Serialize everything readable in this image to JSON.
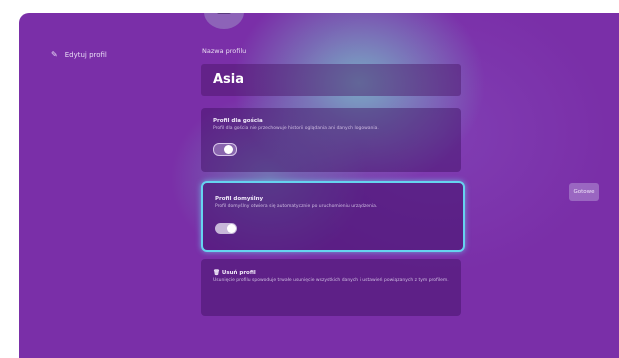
{
  "sidebar": {
    "item": {
      "icon": "pencil-icon",
      "label": "Edytuj profil"
    }
  },
  "profile": {
    "name_label": "Nazwa profilu",
    "name_value": "Asia"
  },
  "cards": {
    "guest": {
      "title": "Profil dla gościa",
      "description": "Profil dla gościa nie przechowuje historii oglądania ani danych logowania.",
      "toggle_on": false
    },
    "default": {
      "title": "Profil domyślny",
      "description": "Profil domyślny otwiera się automatycznie po uruchomieniu urządzenia.",
      "toggle_on": true
    },
    "delete": {
      "icon": "trash-icon",
      "title": "Usuń profil",
      "description": "Usunięcie profilu spowoduje trwałe usunięcie wszystkich danych i ustawień powiązanych z tym profilem."
    }
  },
  "actions": {
    "done_label": "Gotowe"
  },
  "colors": {
    "background": "#7a2fa8",
    "focus": "#66d3ef"
  }
}
